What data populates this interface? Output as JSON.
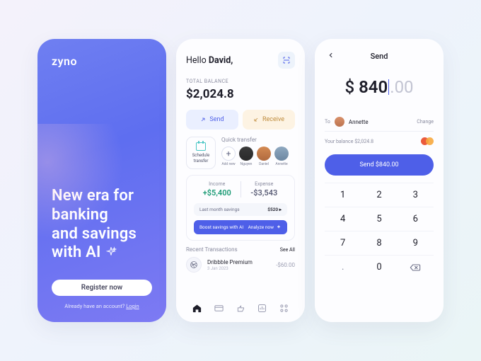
{
  "promo": {
    "brand": "zyno",
    "headline_l1": "New era for",
    "headline_l2": "banking",
    "headline_l3": "and savings",
    "headline_l4": "with AI",
    "register_label": "Register now",
    "login_prefix": "Already have an account? ",
    "login_link": "Login"
  },
  "home": {
    "greet_prefix": "Hello ",
    "greet_name": "David,",
    "balance_label": "TOTAL BALANCE",
    "balance_value": "$2,024.8",
    "send_label": "Send",
    "receive_label": "Receive",
    "schedule_l1": "Schedule",
    "schedule_l2": "transfer",
    "quick_label": "Quick transfer",
    "contacts": [
      {
        "name": "Add new"
      },
      {
        "name": "Nguyen"
      },
      {
        "name": "Daniel"
      },
      {
        "name": "Annette"
      }
    ],
    "income_label": "Income",
    "income_value": "+$5,400",
    "expense_label": "Expense",
    "expense_value": "-$3,543",
    "lms_label": "Last month savings",
    "lms_value": "$520",
    "boost_label": "Boost savings with AI",
    "boost_action": "Analyze now",
    "rt_title": "Recent Transactions",
    "rt_see": "See All",
    "rt_item_name": "Dribbble Premium",
    "rt_item_date": "3 Jan 2023",
    "rt_item_amount": "-$60.00"
  },
  "send": {
    "title": "Send",
    "currency": "$",
    "amount_main": "840",
    "amount_frac": ".00",
    "to_label": "To",
    "to_name": "Annette",
    "change_label": "Change",
    "your_balance_label": "Your balance",
    "your_balance_value": "$2,024.8",
    "send_button": "Send $840.00",
    "keys": [
      "1",
      "2",
      "3",
      "4",
      "5",
      "6",
      "7",
      "8",
      "9",
      ".",
      "0",
      "⌫"
    ]
  }
}
